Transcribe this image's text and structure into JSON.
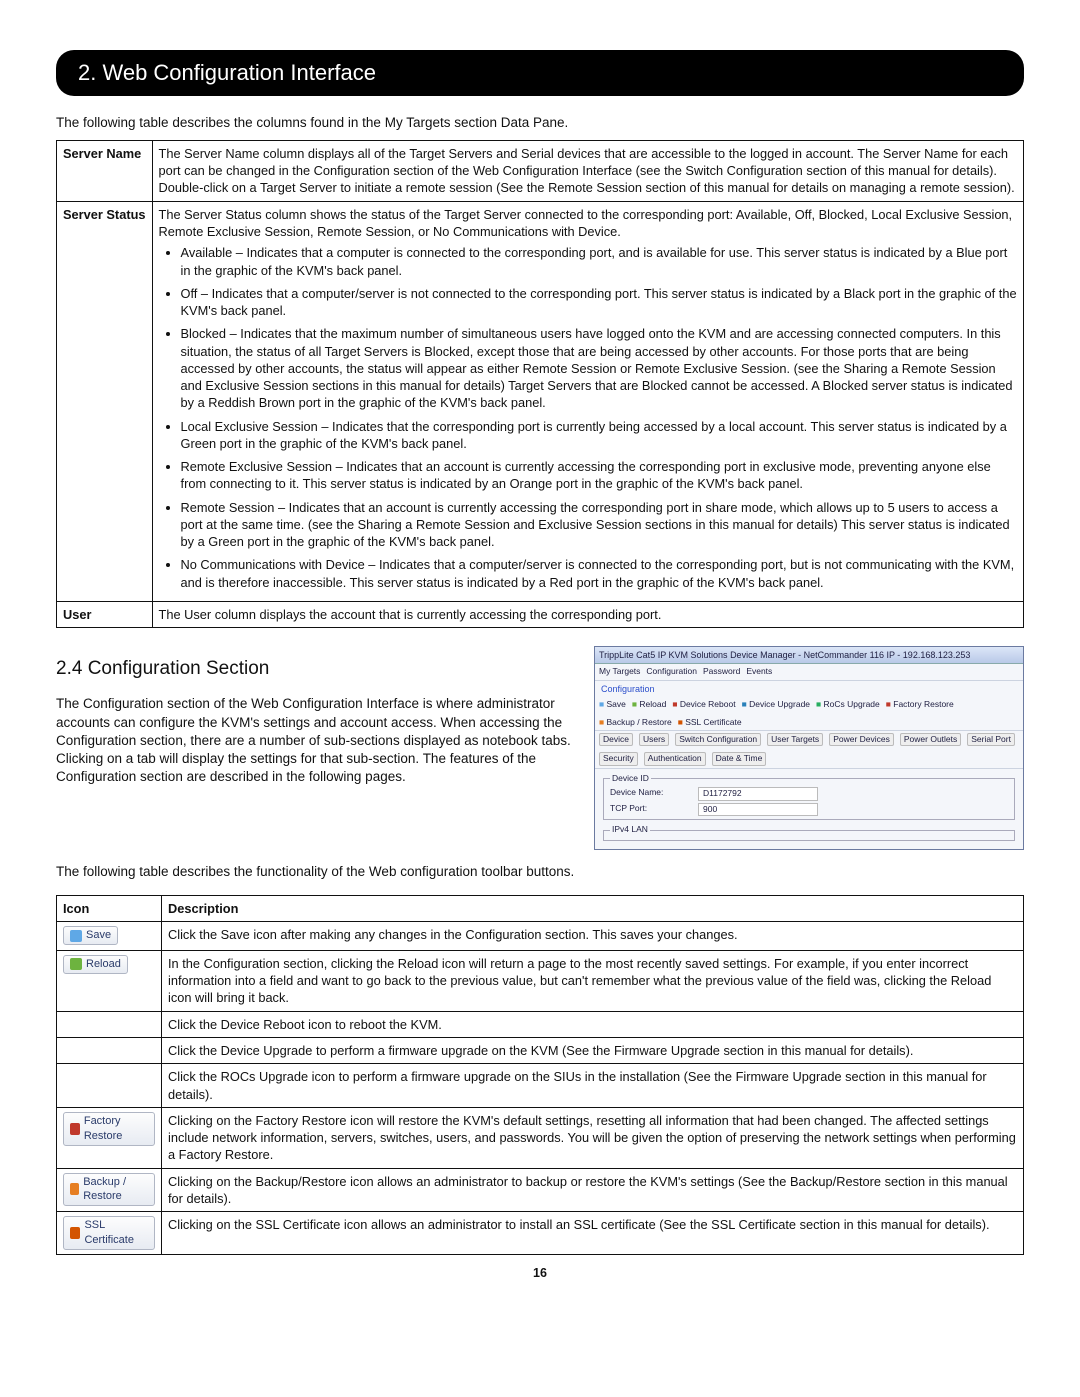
{
  "header": "2. Web Configuration Interface",
  "intro": "The following table describes the columns found in the My Targets section Data Pane.",
  "t1": {
    "r1_h": "Server Name",
    "r1": "The Server Name column displays all of the Target Servers and Serial devices that are accessible to the logged in account. The Server Name for each port can be changed in the Configuration section of the Web Configuration Interface (see the Switch Configuration section of this manual for details). Double-click on a Target Server to initiate a remote session (See the Remote Session section of this manual for details on managing a remote session).",
    "r2_h": "Server Status",
    "r2_lead": "The Server Status column shows the status of the Target Server connected to the corresponding port: Available, Off, Blocked, Local Exclusive Session, Remote Exclusive Session, Remote Session, or No Communications with Device.",
    "li_avail": "Available – Indicates that a computer is connected to the corresponding port, and is available for use. This server status is indicated by a Blue port in the graphic of the KVM's back panel.",
    "li_off": "Off – Indicates that a computer/server is not connected to the corresponding port. This server status is indicated by a Black port in the graphic of the KVM's back panel.",
    "li_blocked": "Blocked – Indicates that the maximum number of simultaneous users have logged onto the KVM and are accessing connected computers. In this situation, the status of all Target Servers is Blocked, except those that are being accessed by other accounts. For those ports that are being accessed by other accounts, the status will appear as either Remote Session or Remote Exclusive Session. (see the Sharing a Remote Session and Exclusive Session sections in this manual for details) Target Servers that are Blocked cannot be accessed. A Blocked server status is indicated by a Reddish Brown port in the graphic of the KVM's back panel.",
    "li_local": "Local Exclusive Session – Indicates that the corresponding port is currently being accessed by a local account. This server status is indicated by a Green port in the graphic of the KVM's back panel.",
    "li_rexcl": "Remote Exclusive Session – Indicates that an account is currently accessing the corresponding port in exclusive mode, preventing anyone else from connecting to it. This server status is indicated by an Orange port in the graphic of the KVM's back panel.",
    "li_rsess": "Remote Session – Indicates that an account is currently accessing the corresponding port in share mode, which allows up to 5 users to access a port at the same time. (see the Sharing a Remote Session and Exclusive Session sections in this manual for details) This server status is indicated by a Green port in the graphic of the KVM's back panel.",
    "li_nocom": "No Communications with Device – Indicates that a computer/server is connected to the corresponding port, but is not communicating with the KVM, and is therefore inaccessible. This server status is indicated by a Red port in the graphic of the KVM's back panel.",
    "r3_h": "User",
    "r3": "The User column displays the account that is currently accessing the corresponding port."
  },
  "sec24_h": "2.4 Configuration Section",
  "sec24_body": "The Configuration section of the Web Configuration Interface is where administrator accounts can configure the KVM's settings and account access. When accessing the Configuration section, there are a number of sub-sections displayed as notebook tabs. Clicking on a tab will display the settings for that sub-section. The features of the Configuration section are described in the following pages.",
  "thumb": {
    "title": "TrippLite Cat5 IP KVM Solutions Device Manager - NetCommander 116 IP - 192.168.123.253",
    "tabs1": [
      "My Targets",
      "Configuration",
      "Password",
      "Events"
    ],
    "conf": "Configuration",
    "toolbar": [
      "Save",
      "Reload",
      "Device Reboot",
      "Device Upgrade",
      "RoCs Upgrade",
      "Factory Restore",
      "Backup / Restore",
      "SSL Certificate"
    ],
    "tabs2": [
      "Device",
      "Users",
      "Switch Configuration",
      "User Targets",
      "Power Devices",
      "Power Outlets",
      "Serial Port",
      "Security",
      "Authentication",
      "Date & Time"
    ],
    "fs1": "Device ID",
    "fs1_lab1": "Device Name:",
    "fs1_val1": "D1172792",
    "fs1_lab2": "TCP Port:",
    "fs1_val2": "900",
    "fs2": "IPv4 LAN"
  },
  "toolbar_intro": "The following table describes the functionality of the Web configuration toolbar buttons.",
  "ih": {
    "icon": "Icon",
    "desc": "Description"
  },
  "icons": {
    "save_label": "Save",
    "save": "Click the Save icon after making any changes in the Configuration section. This saves your changes.",
    "reload_label": "Reload",
    "reload": "In the Configuration section, clicking the Reload icon will return a page to the most recently saved settings. For example, if you enter incorrect information into a field and want to go back to the previous value, but can't remember what the previous value of the field was, clicking the Reload icon will bring it back.",
    "reboot": "Click the Device Reboot icon to reboot the KVM.",
    "upgrade": "Click the Device Upgrade to perform a firmware upgrade on the KVM (See the Firmware Upgrade section in this manual for details).",
    "rocs": "Click the ROCs Upgrade icon to perform a firmware upgrade on the SIUs in the installation (See the Firmware Upgrade section in this manual for details).",
    "fr_label": "Factory Restore",
    "fr": "Clicking on the Factory Restore icon will restore the KVM's default settings, resetting all information that had been changed. The affected settings include network information, servers, switches, users, and passwords. You will be given the option of preserving the network settings when performing a Factory Restore.",
    "br_label": "Backup / Restore",
    "br": "Clicking on the Backup/Restore icon allows an administrator to backup or restore the KVM's settings (See the Backup/Restore section in this manual for details).",
    "ssl_label": "SSL Certificate",
    "ssl": "Clicking on the SSL Certificate icon allows an administrator to install an SSL certificate (See the SSL Certificate section in this manual for details)."
  },
  "page": "16"
}
